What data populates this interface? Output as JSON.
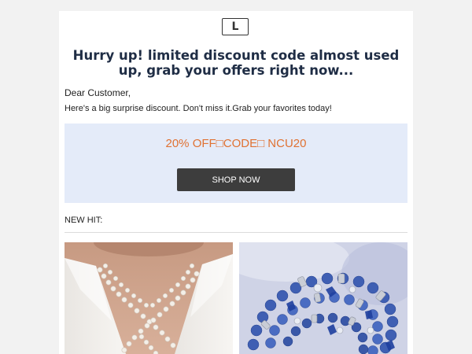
{
  "logo": {
    "letter": "L"
  },
  "headline": "Hurry up! limited discount code almost used up, grab your offers right now...",
  "greeting": "Dear Customer,",
  "intro": "Here's a big surprise discount. Don't miss it.Grab your favorites today!",
  "promo": {
    "text": "20% OFF□CODE□ NCU20",
    "button_label": "SHOP NOW",
    "accent_color": "#e07233",
    "background_color": "#e4ebf9"
  },
  "new_hit": {
    "label": "NEW HIT:",
    "products": [
      {
        "image": "pearl-necklace-photo"
      },
      {
        "image": "blue-bead-bracelets-photo"
      }
    ]
  }
}
